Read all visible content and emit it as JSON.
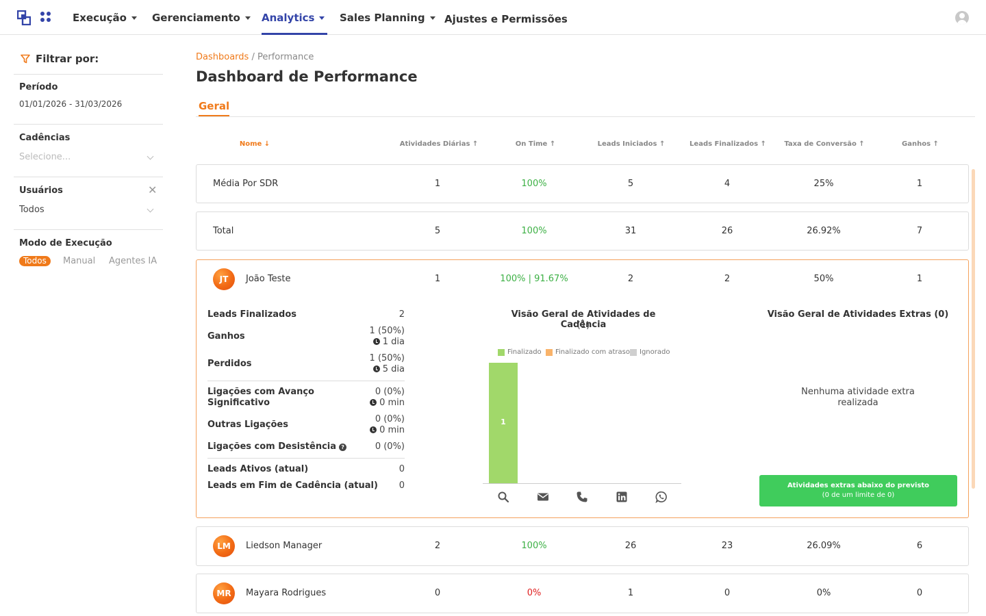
{
  "nav": {
    "items": [
      {
        "label": "Execução",
        "caret": true
      },
      {
        "label": "Gerenciamento",
        "caret": true
      },
      {
        "label": "Analytics",
        "caret": true,
        "active": true
      },
      {
        "label": "Sales Planning",
        "caret": true
      },
      {
        "label": "Ajustes e Permissões",
        "caret": false
      }
    ]
  },
  "sidebar": {
    "filter_title": "Filtrar por:",
    "periodo_label": "Período",
    "periodo_value": "01/01/2026 - 31/03/2026",
    "cadencias_label": "Cadências",
    "cadencias_placeholder": "Selecione...",
    "usuarios_label": "Usuários",
    "usuarios_value": "Todos",
    "modo_label": "Modo de Execução",
    "modo_options": [
      "Todos",
      "Manual",
      "Agentes IA"
    ],
    "modo_selected": "Todos"
  },
  "breadcrumb": {
    "link": "Dashboards",
    "separator": "/",
    "current": "Performance"
  },
  "page_title": "Dashboard de Performance",
  "tab": "Geral",
  "columns": [
    "Nome ↓",
    "Atividades Diárias ↑",
    "On Time ↑",
    "Leads Iniciados ↑",
    "Leads Finalizados ↑",
    "Taxa de Conversão ↑",
    "Ganhos ↑"
  ],
  "rows": [
    {
      "name": "Média Por SDR",
      "atividades": "1",
      "on_time": "100%",
      "iniciados": "5",
      "finalizados": "4",
      "conversao": "25%",
      "ganhos": "1"
    },
    {
      "name": "Total",
      "atividades": "5",
      "on_time": "100%",
      "iniciados": "31",
      "finalizados": "26",
      "conversao": "26.92%",
      "ganhos": "7"
    },
    {
      "initials": "JT",
      "name": "João Teste",
      "atividades": "1",
      "on_time": "100% | 91.67%",
      "iniciados": "2",
      "finalizados": "2",
      "conversao": "50%",
      "ganhos": "1"
    },
    {
      "initials": "LM",
      "name": "Liedson Manager",
      "atividades": "2",
      "on_time": "100%",
      "iniciados": "26",
      "finalizados": "23",
      "conversao": "26.09%",
      "ganhos": "6"
    },
    {
      "initials": "MR",
      "name": "Mayara Rodrigues",
      "atividades": "0",
      "on_time": "0%",
      "iniciados": "1",
      "finalizados": "0",
      "conversao": "0%",
      "ganhos": "0"
    }
  ],
  "details": {
    "leads_finalizados": {
      "label": "Leads Finalizados",
      "value": "2"
    },
    "ganhos": {
      "label": "Ganhos",
      "value": "1 (50%)",
      "time": "1 dia"
    },
    "perdidos": {
      "label": "Perdidos",
      "value": "1 (50%)",
      "time": "5 dia"
    },
    "lig_avanco": {
      "label_line1": "Ligações com Avanço",
      "label_line2": "Significativo",
      "value": "0 (0%)",
      "time": "0 min"
    },
    "outras": {
      "label": "Outras Ligações",
      "value": "0 (0%)",
      "time": "0 min"
    },
    "desistencia": {
      "label": "Ligações com Desistência",
      "value": "0 (0%)"
    },
    "ativos": {
      "label": "Leads Ativos (atual)",
      "value": "0"
    },
    "fim_cadencia": {
      "label": "Leads em Fim de Cadência (atual)",
      "value": "0"
    },
    "chart_title": "Visão Geral de Atividades de Cadência",
    "chart_count": "(1)",
    "extras_title": "Visão Geral de Atividades Extras (0)",
    "extras_empty": "Nenhuma atividade extra realizada",
    "extras_btn_line1": "Atividades extras abaixo do previsto",
    "extras_btn_line2": "(0 de um limite de 0)"
  },
  "chart_data": {
    "type": "bar",
    "title": "Visão Geral de Atividades de Cadência",
    "categories": [
      "search",
      "email",
      "phone",
      "linkedin",
      "whatsapp"
    ],
    "series": [
      {
        "name": "Finalizado",
        "color": "#a1d86a",
        "values": [
          1,
          0,
          0,
          0,
          0
        ]
      },
      {
        "name": "Finalizado com atraso",
        "color": "#f9b36a",
        "values": [
          0,
          0,
          0,
          0,
          0
        ]
      },
      {
        "name": "Ignorado",
        "color": "#cfcfcf",
        "values": [
          0,
          0,
          0,
          0,
          0
        ]
      }
    ],
    "ylim": [
      0,
      1
    ],
    "legend": "top"
  },
  "colors": {
    "brand": "#3344a8",
    "accent": "#f07a1a",
    "success": "#3cb044",
    "danger": "#e02020"
  }
}
